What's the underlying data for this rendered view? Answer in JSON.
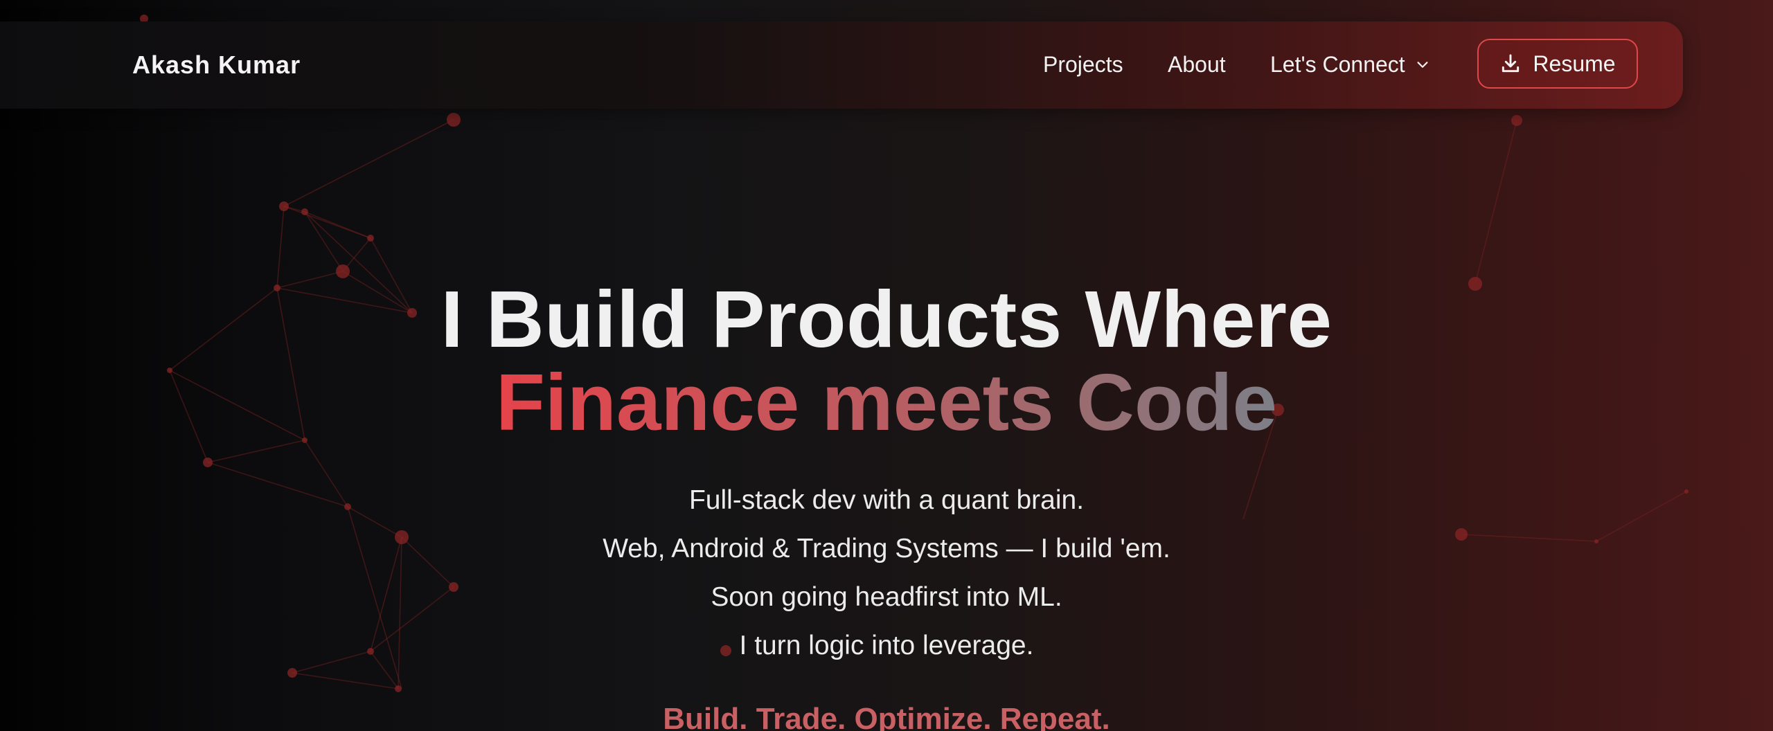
{
  "nav": {
    "brand": "Akash Kumar",
    "links": [
      "Projects",
      "About",
      "Let's Connect"
    ],
    "resume_label": "Resume"
  },
  "hero": {
    "title_line1": "I Build Products Where",
    "title_line2": "Finance meets Code",
    "subtitle_lines": [
      "Full-stack dev with a quant brain.",
      "Web, Android & Trading Systems — I build 'em.",
      "Soon going headfirst into ML.",
      "I turn logic into leverage."
    ],
    "tagline": "Build. Trade. Optimize. Repeat."
  },
  "icons": {
    "connect_dropdown": "chevron-down-icon",
    "resume": "download-icon"
  },
  "colors": {
    "accent": "#e5434a",
    "accent_muted": "#c86064",
    "resume_border": "#e0474b",
    "gradient_end": "#7d7f88"
  }
}
